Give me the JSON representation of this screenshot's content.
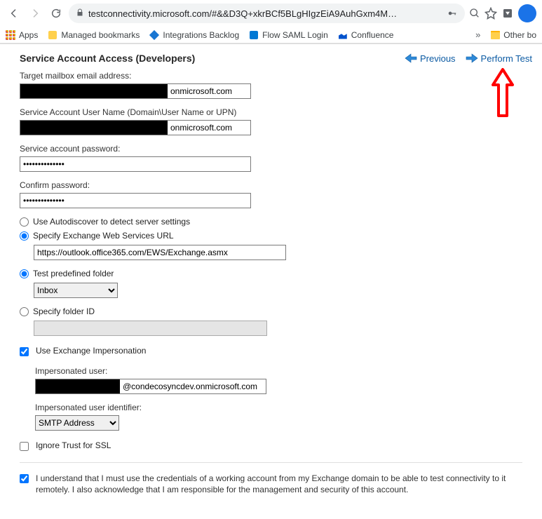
{
  "browser": {
    "url": "testconnectivity.microsoft.com/#&&D3Q+xkrBCf5BLgHIgzEiA9AuhGxm4M…",
    "bookmarks_label_apps": "Apps",
    "bookmarks": [
      {
        "label": "Managed bookmarks"
      },
      {
        "label": "Integrations Backlog"
      },
      {
        "label": "Flow SAML Login"
      },
      {
        "label": "Confluence"
      }
    ],
    "other_bookmarks": "Other bo"
  },
  "header": {
    "title": "Service Account Access (Developers)",
    "prev_label": "Previous",
    "perform_label": "Perform Test"
  },
  "form": {
    "target_label": "Target mailbox email address:",
    "target_suffix": "onmicrosoft.com",
    "svc_user_label": "Service Account User Name (Domain\\User Name or UPN)",
    "svc_user_suffix": "onmicrosoft.com",
    "pwd_label": "Service account password:",
    "pwd_value": "••••••••••••••",
    "confirm_label": "Confirm password:",
    "confirm_value": "••••••••••••••",
    "radio_autodiscover": "Use Autodiscover to detect server settings",
    "radio_specify_url": "Specify Exchange Web Services URL",
    "ews_url": "https://outlook.office365.com/EWS/Exchange.asmx",
    "radio_predef_folder": "Test predefined folder",
    "folder_selected": "Inbox",
    "radio_folder_id": "Specify folder ID",
    "chk_impersonation": "Use Exchange Impersonation",
    "imp_user_label": "Impersonated user:",
    "imp_user_suffix": "@condecosyncdev.onmicrosoft.com",
    "imp_id_label": "Impersonated user identifier:",
    "imp_id_selected": "SMTP Address",
    "chk_ignore_ssl": "Ignore Trust for SSL",
    "ack_text": "I understand that I must use the credentials of a working account from my Exchange domain to be able to test connectivity to it remotely. I also acknowledge that I am responsible for the management and security of this account."
  }
}
